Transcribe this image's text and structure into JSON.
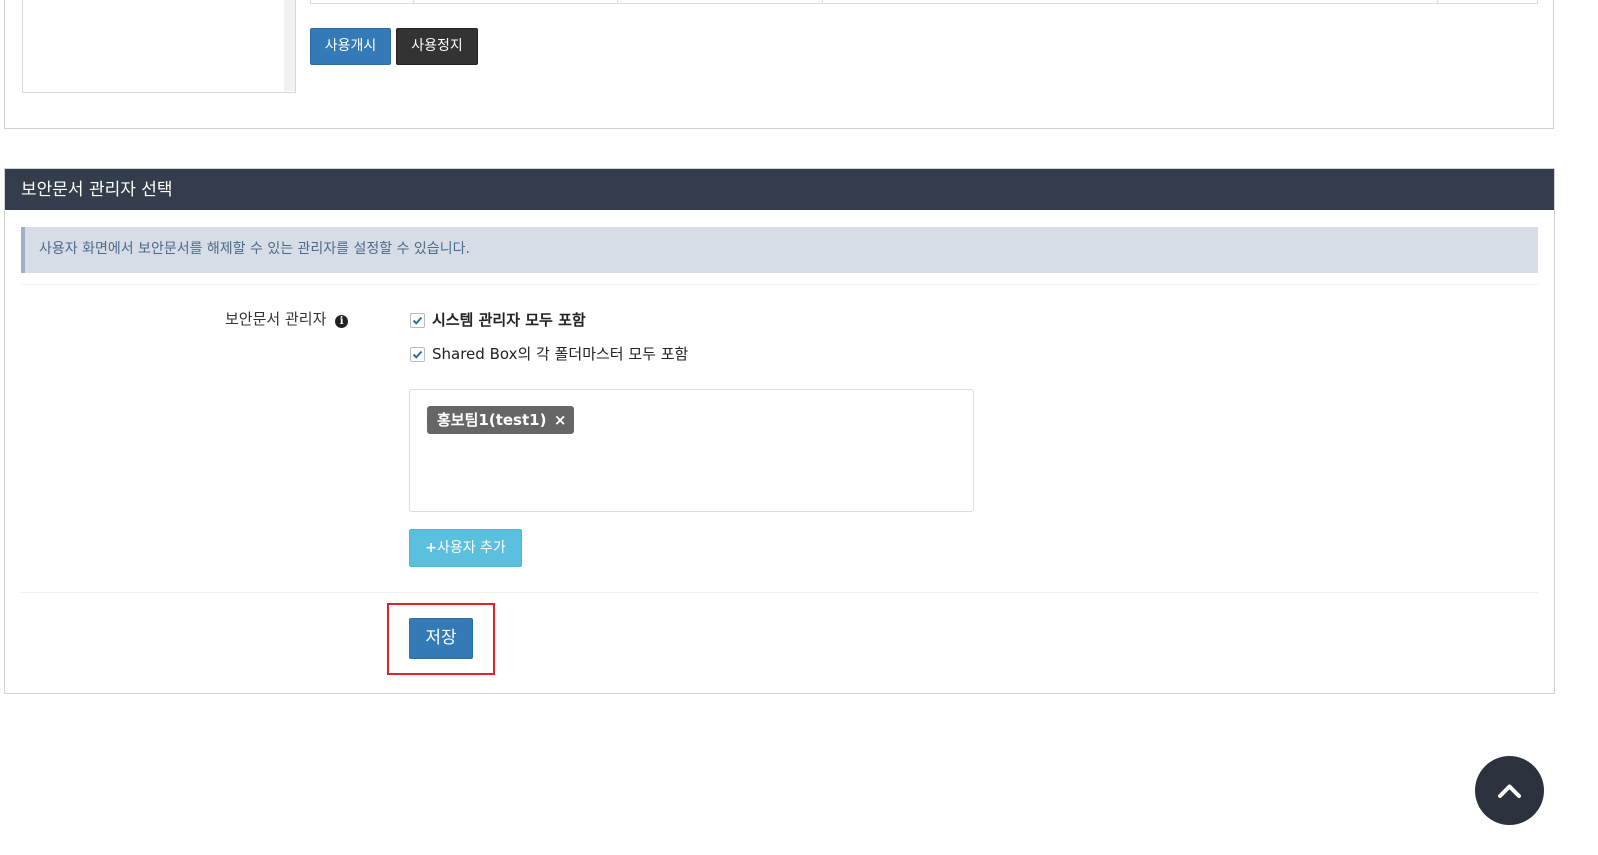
{
  "top_panel": {
    "start_button": "사용개시",
    "stop_button": "사용정지"
  },
  "section": {
    "title": "보안문서 관리자 선택",
    "info_text": "사용자 화면에서 보안문서를 해제할 수 있는 관리자를 설정할 수 있습니다.",
    "form": {
      "label": "보안문서 관리자",
      "label_icon": "info-circle-icon",
      "checkboxes": [
        {
          "label": "시스템 관리자 모두 포함",
          "checked": true
        },
        {
          "label": "Shared Box의 각 폴더마스터 모두 포함",
          "checked": true
        }
      ],
      "selected_users": [
        {
          "label": "홍보팀1(test1)",
          "remove_glyph": "×"
        }
      ],
      "add_user_icon": "+",
      "add_user_button": "사용자 추가",
      "save_button": "저장"
    }
  },
  "scroll_top_icon": "chevron-up-icon",
  "colors": {
    "header_bg": "#343d4b",
    "primary": "#337ab7",
    "dark_button": "#333333",
    "info_bg": "#d6dde7",
    "info_button": "#5bc0de",
    "highlight": "#e0222b"
  }
}
